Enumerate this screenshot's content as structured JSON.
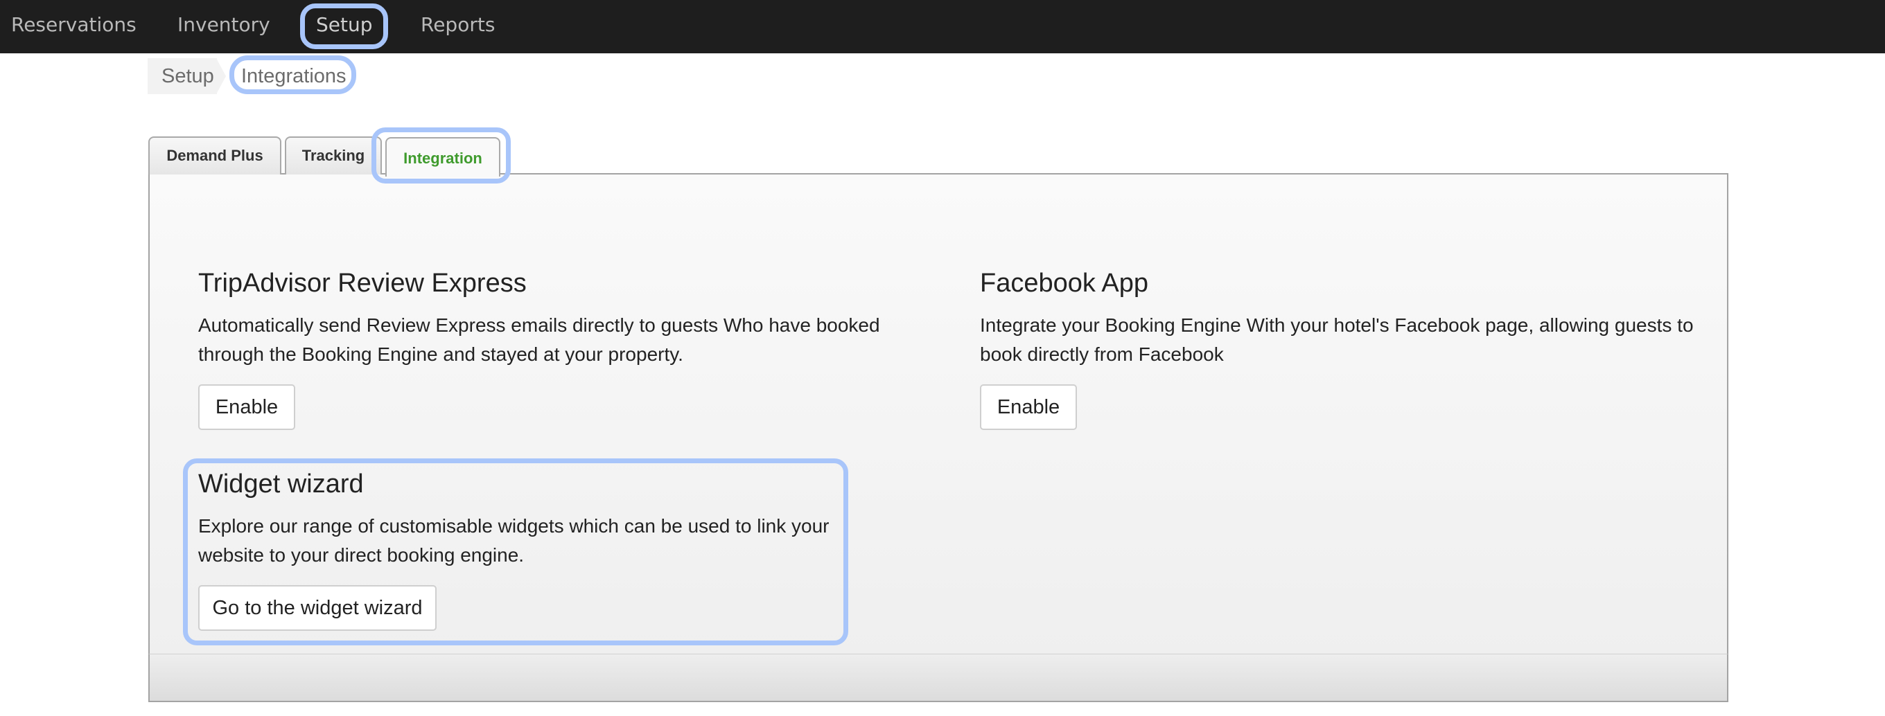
{
  "nav": {
    "items": [
      {
        "label": "Reservations"
      },
      {
        "label": "Inventory"
      },
      {
        "label": "Setup"
      },
      {
        "label": "Reports"
      }
    ]
  },
  "breadcrumb": {
    "items": [
      {
        "label": "Setup"
      },
      {
        "label": "Integrations"
      }
    ]
  },
  "tabs": [
    {
      "label": "Demand Plus"
    },
    {
      "label": "Tracking"
    },
    {
      "label": "Integration",
      "active": true
    }
  ],
  "cards": {
    "tripadvisor": {
      "title": "TripAdvisor Review Express",
      "description": "Automatically send Review Express emails directly to guests Who have booked through the Booking Engine and stayed at your property.",
      "button": "Enable"
    },
    "facebook": {
      "title": "Facebook App",
      "description": "Integrate your Booking Engine With your hotel's Facebook page, allowing guests to book directly from Facebook",
      "button": "Enable"
    },
    "widget": {
      "title": "Widget wizard",
      "description": "Explore our range of customisable widgets which can be used to link your website to your direct booking engine.",
      "button": "Go to the widget wizard"
    }
  },
  "colors": {
    "nav_bg": "#1e1e1e",
    "active_tab_text": "#3f9b2d",
    "highlight": "#a8c5fa"
  }
}
